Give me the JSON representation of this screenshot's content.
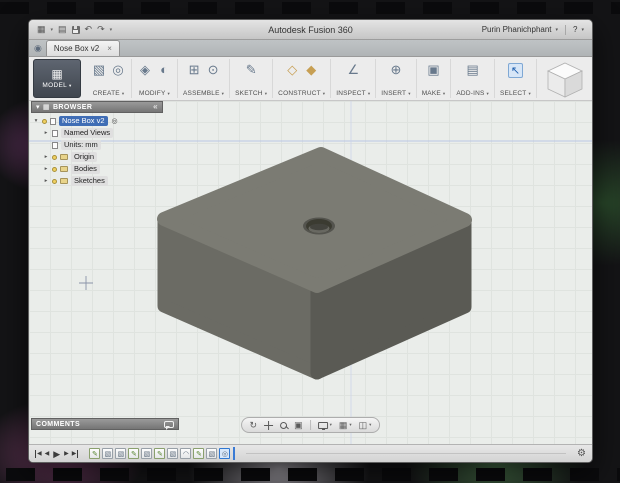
{
  "app": {
    "title": "Autodesk Fusion 360",
    "user": "Purin Phanichphant",
    "help_label": "?"
  },
  "titlebar_icons": {
    "data_panel": "▦",
    "file_menu": "▤",
    "undo": "↶",
    "redo": "↷",
    "caret": "▾"
  },
  "tabs": {
    "app_icon": "◉",
    "active": "Nose Box v2",
    "close": "×"
  },
  "ribbon": {
    "workspace": {
      "label": "MODEL",
      "icon": "▦"
    },
    "caret": "▾",
    "groups": [
      {
        "label": "CREATE",
        "icons": [
          {
            "name": "box-icon",
            "glyph": "▧"
          },
          {
            "name": "cylinder-icon",
            "glyph": "◎"
          }
        ]
      },
      {
        "label": "MODIFY",
        "icons": [
          {
            "name": "press-pull-icon",
            "glyph": "◈"
          },
          {
            "name": "fillet-icon",
            "glyph": "◐"
          }
        ]
      },
      {
        "label": "ASSEMBLE",
        "icons": [
          {
            "name": "new-component-icon",
            "glyph": "⊞"
          },
          {
            "name": "joint-icon",
            "glyph": "⊙"
          }
        ]
      },
      {
        "label": "SKETCH",
        "icons": [
          {
            "name": "sketch-icon",
            "glyph": "✎"
          }
        ]
      },
      {
        "label": "CONSTRUCT",
        "icons": [
          {
            "name": "plane-icon",
            "glyph": "◇"
          },
          {
            "name": "axis-icon",
            "glyph": "◆"
          }
        ]
      },
      {
        "label": "INSPECT",
        "icons": [
          {
            "name": "measure-icon",
            "glyph": "∠"
          }
        ]
      },
      {
        "label": "INSERT",
        "icons": [
          {
            "name": "insert-icon",
            "glyph": "⊕"
          }
        ]
      },
      {
        "label": "MAKE",
        "icons": [
          {
            "name": "make-icon",
            "glyph": "▣"
          }
        ]
      },
      {
        "label": "ADD-INS",
        "icons": [
          {
            "name": "addins-icon",
            "glyph": "▤"
          }
        ]
      },
      {
        "label": "SELECT",
        "icons": [
          {
            "name": "select-cursor-icon",
            "glyph": "↖"
          }
        ]
      }
    ]
  },
  "browser": {
    "title": "BROWSER",
    "panel_icon": "▦",
    "collapse": "«",
    "root": {
      "label": "Nose Box v2",
      "radio": "◎"
    },
    "items": [
      {
        "label": "Named Views"
      },
      {
        "label": "Units: mm"
      },
      {
        "label": "Origin"
      },
      {
        "label": "Bodies"
      },
      {
        "label": "Sketches"
      }
    ],
    "expander_closed": "▸",
    "expander_open": "▾"
  },
  "comments": {
    "label": "COMMENTS"
  },
  "nav": {
    "orbit": "↻",
    "fit": "▣",
    "grid": "▦",
    "viewports": "◫",
    "caret": "▾"
  },
  "timeline": {
    "playback": {
      "prev": "◀",
      "play": "▶",
      "next": "▶"
    },
    "features": [
      {
        "name": "sketch",
        "glyph": "✎"
      },
      {
        "name": "extrude",
        "glyph": "▧"
      },
      {
        "name": "extrude",
        "glyph": "▧"
      },
      {
        "name": "sketch",
        "glyph": "✎"
      },
      {
        "name": "extrude",
        "glyph": "▧"
      },
      {
        "name": "sketch",
        "glyph": "✎"
      },
      {
        "name": "extrude",
        "glyph": "▧"
      },
      {
        "name": "fillet",
        "glyph": "◠"
      },
      {
        "name": "sketch",
        "glyph": "✎"
      },
      {
        "name": "extrude",
        "glyph": "▧"
      },
      {
        "name": "hole",
        "glyph": "◎"
      }
    ],
    "gear": "⚙"
  },
  "colors": {
    "selection_blue": "#3f6db5",
    "accent_blue": "#2f77d1",
    "model_top": "#7b7b73",
    "model_left": "#6b6b64",
    "model_right": "#5a5a54"
  }
}
